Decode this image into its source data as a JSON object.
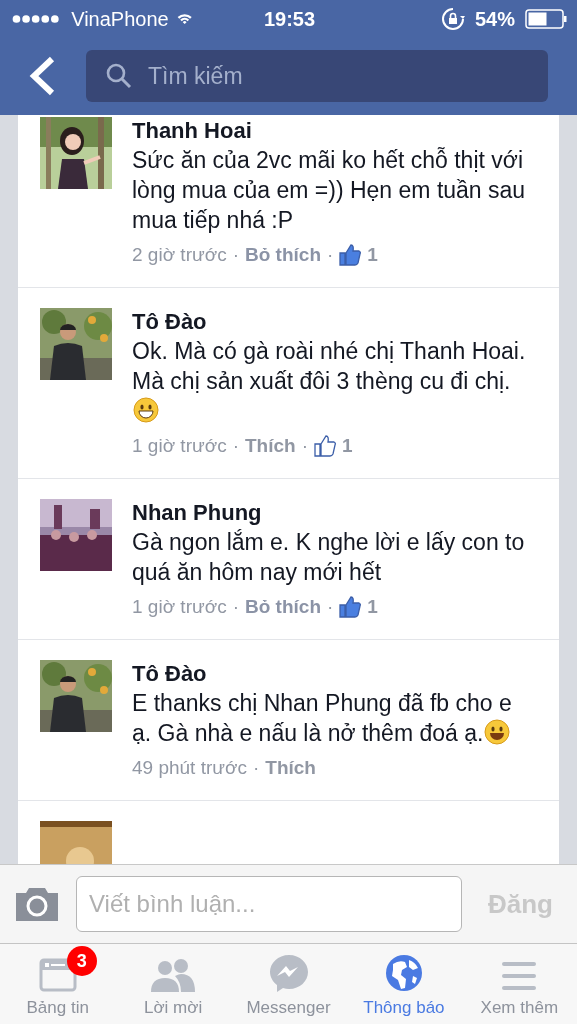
{
  "status_bar": {
    "carrier": "VinaPhone",
    "time": "19:53",
    "battery": "54%"
  },
  "search": {
    "placeholder": "Tìm kiếm"
  },
  "comments": [
    {
      "name": "Thanh Hoai",
      "text": "Sức ăn của 2vc mãi ko hết chỗ thịt với lòng mua của em =)) Hẹn em tuần sau mua tiếp nhá :P",
      "kind": "plain",
      "time": "2 giờ trước",
      "dots": [
        "·",
        "·"
      ],
      "action": "Bỏ thích",
      "liked": true,
      "likes": "1"
    },
    {
      "name": "Tô Đào",
      "text": "Ok. Mà có gà roài nhé chị Thanh Hoai. Mà chị sản xuất đôi 3 thèng cu đi chị.",
      "kind": "grin",
      "time": "1 giờ trước",
      "dots": [
        "·",
        "·"
      ],
      "action": "Thích",
      "liked": false,
      "likes": "1"
    },
    {
      "name": "Nhan Phung",
      "text": "Gà ngon lắm e. K nghe lời e lấy con to quá ăn hôm nay mới hết",
      "kind": "plain",
      "time": "1 giờ trước",
      "dots": [
        "·",
        "·"
      ],
      "action": "Bỏ thích",
      "liked": true,
      "likes": "1"
    },
    {
      "name": "Tô Đào",
      "text": "E thanks chị Nhan Phung đã fb cho e ạ. Gà nhà e nấu là nở thêm đoá ạ.",
      "kind": "smile",
      "time": "49 phút trước",
      "dots": [
        "·"
      ],
      "action": "Thích"
    }
  ],
  "composer": {
    "placeholder": "Viết bình luận...",
    "post": "Đăng"
  },
  "tabs": [
    {
      "label": "Bảng tin",
      "badge": "3",
      "selected": false
    },
    {
      "label": "Lời mời",
      "selected": false
    },
    {
      "label": "Messenger",
      "selected": false
    },
    {
      "label": "Thông báo",
      "selected": true
    },
    {
      "label": "Xem thêm",
      "selected": false
    }
  ]
}
